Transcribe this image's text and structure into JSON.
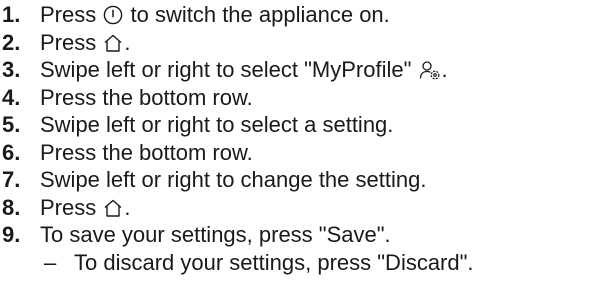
{
  "steps": [
    {
      "num": "1.",
      "before": "Press",
      "icon": "power-icon",
      "after": "to switch the appliance on."
    },
    {
      "num": "2.",
      "before": "Press",
      "icon": "home-icon",
      "after": "."
    },
    {
      "num": "3.",
      "before": "Swipe left or right to select \"MyProfile\"",
      "icon": "profile-settings-icon",
      "after": "."
    },
    {
      "num": "4.",
      "text": "Press the bottom row."
    },
    {
      "num": "5.",
      "text": "Swipe left or right to select a setting."
    },
    {
      "num": "6.",
      "text": "Press the bottom row."
    },
    {
      "num": "7.",
      "text": "Swipe left or right to change the setting."
    },
    {
      "num": "8.",
      "before": "Press",
      "icon": "home-icon",
      "after": "."
    },
    {
      "num": "9.",
      "text": "To save your settings, press \"Save\"."
    }
  ],
  "substep": {
    "dash": "–",
    "text": "To discard your settings, press \"Discard\"."
  }
}
